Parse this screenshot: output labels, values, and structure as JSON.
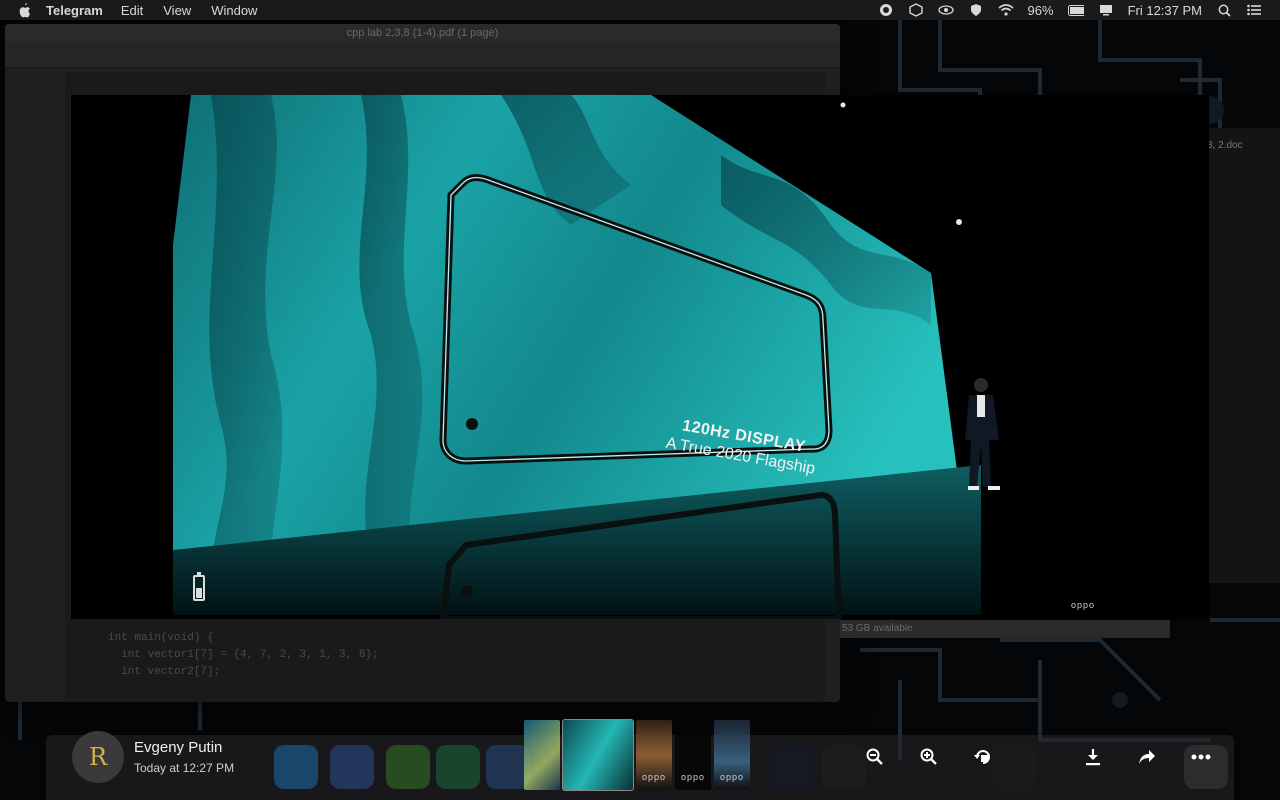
{
  "menubar": {
    "app_name": "Telegram",
    "items": [
      "Edit",
      "View",
      "Window"
    ],
    "battery_percent": "96%",
    "clock": "Fri 12:37 PM"
  },
  "background_window": {
    "title": "cpp lab 2,3,8 (1-4).pdf (1 page)",
    "code_lines": [
      "int main(void) {",
      "",
      "  int vector1[7] = {4, 7, 2, 3, 1, 3, 8};",
      "  int vector2[7];"
    ],
    "side_doc_label": "3, 2.doc",
    "storage_text": "53 GB available"
  },
  "photo": {
    "headline": "120Hz DISPLAY",
    "subline": "A True 2020 Flagship",
    "brand": "oppo",
    "battery_level": 0.5
  },
  "media_viewer": {
    "sender_name": "Evgeny Putin",
    "sender_time": "Today at 12:27 PM",
    "thumb_brand": "oppo",
    "thumbnails": [
      "thumb-1",
      "thumb-2-current",
      "thumb-3",
      "thumb-4",
      "thumb-5"
    ],
    "actions": [
      "zoom-out-icon",
      "zoom-in-icon",
      "rotate-icon",
      "download-icon",
      "share-icon",
      "more-icon"
    ]
  },
  "colors": {
    "slide_teal": "#1aa6a6",
    "menubar_bg": "#1c1c1e",
    "avatar_logo": "#d6b04a"
  }
}
